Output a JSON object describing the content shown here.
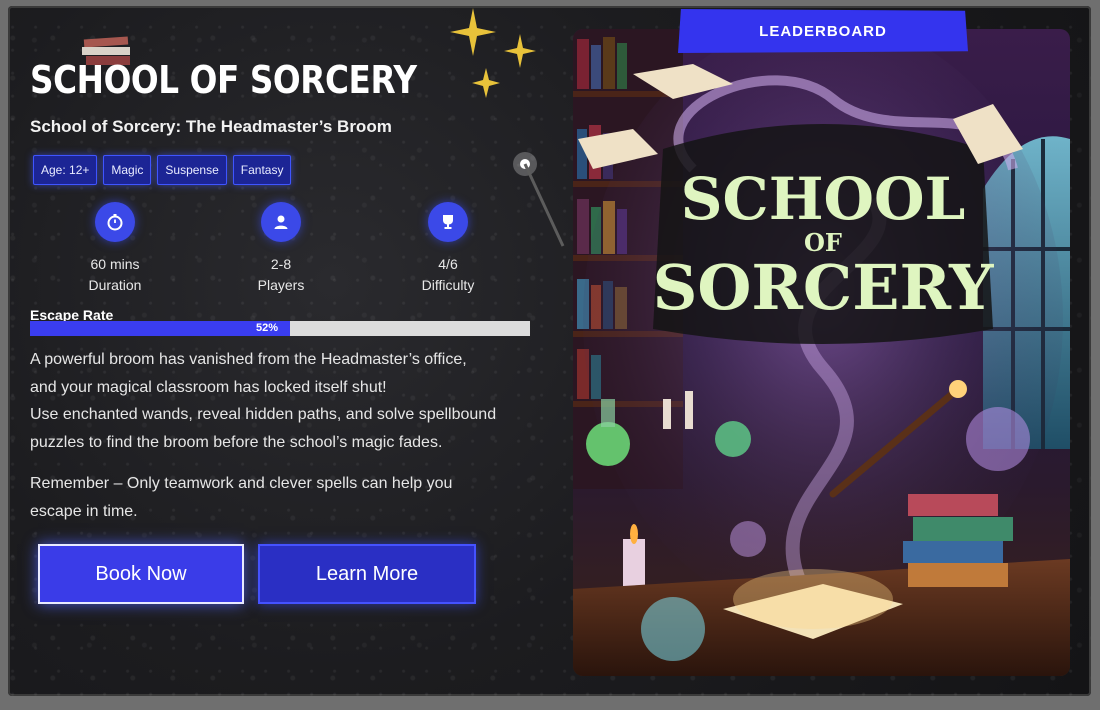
{
  "title": "SCHOOL OF SORCERY",
  "subtitle": "School of Sorcery: The Headmaster’s Broom",
  "tags": [
    "Age: 12+",
    "Magic",
    "Suspense",
    "Fantasy"
  ],
  "stats": [
    {
      "icon": "stopwatch-icon",
      "value": "60 mins",
      "label": "Duration"
    },
    {
      "icon": "user-icon",
      "value": "2-8",
      "label": "Players"
    },
    {
      "icon": "trophy-icon",
      "value": "4/6",
      "label": "Difficulty"
    }
  ],
  "escape_rate": {
    "label": "Escape Rate",
    "percent": 52,
    "text": "52%"
  },
  "description": [
    "A powerful broom has vanished from the Headmaster’s office,",
    "and your magical classroom has locked itself shut!",
    "Use enchanted wands, reveal hidden paths, and solve spellbound",
    "puzzles to find the broom before the school’s magic fades."
  ],
  "reminder": [
    "Remember – Only teamwork and clever spells can help you",
    "escape in time."
  ],
  "buttons": {
    "book": "Book Now",
    "learn": "Learn More"
  },
  "leaderboard": "LEADERBOARD",
  "poster": {
    "line1": "SCHOOL",
    "line2": "OF",
    "line3": "SORCERY"
  },
  "colors": {
    "accent": "#3a3ce8",
    "tag_bg": "#1c2595",
    "background": "#1c1c1f"
  }
}
